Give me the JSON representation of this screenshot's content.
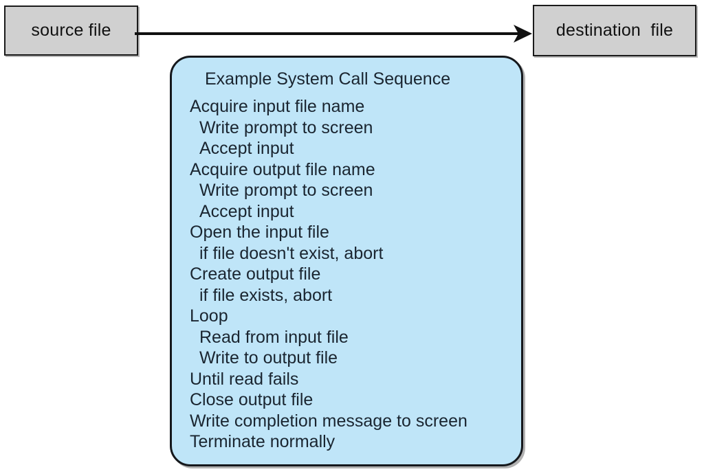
{
  "diagram": {
    "source_box": {
      "label": "source file",
      "fill": "#d0d0d0",
      "border": "#1a1a1a"
    },
    "destination_box": {
      "label": "destination  file",
      "fill": "#d0d0d0",
      "border": "#1a1a1a"
    },
    "arrow": {
      "name": "copy-flow-arrow",
      "direction": "left-to-right",
      "color": "#111111"
    },
    "sequence_panel": {
      "title": "Example System Call Sequence",
      "fill": "#bfe5f8",
      "border": "#15181c",
      "text_color": "#1a2530",
      "lines": [
        {
          "text": "Acquire input file name",
          "indent": false
        },
        {
          "text": "Write prompt to screen",
          "indent": true
        },
        {
          "text": "Accept input",
          "indent": true
        },
        {
          "text": "Acquire output file name",
          "indent": false
        },
        {
          "text": "Write prompt to screen",
          "indent": true
        },
        {
          "text": "Accept input",
          "indent": true
        },
        {
          "text": "Open the input file",
          "indent": false
        },
        {
          "text": "if file doesn't exist, abort",
          "indent": true
        },
        {
          "text": "Create output file",
          "indent": false
        },
        {
          "text": "if file exists, abort",
          "indent": true
        },
        {
          "text": "Loop",
          "indent": false
        },
        {
          "text": "Read from input file",
          "indent": true
        },
        {
          "text": "Write to output file",
          "indent": true
        },
        {
          "text": "Until read fails",
          "indent": false
        },
        {
          "text": "Close output file",
          "indent": false
        },
        {
          "text": "Write completion message to screen",
          "indent": false
        },
        {
          "text": "Terminate normally",
          "indent": false
        }
      ]
    }
  }
}
